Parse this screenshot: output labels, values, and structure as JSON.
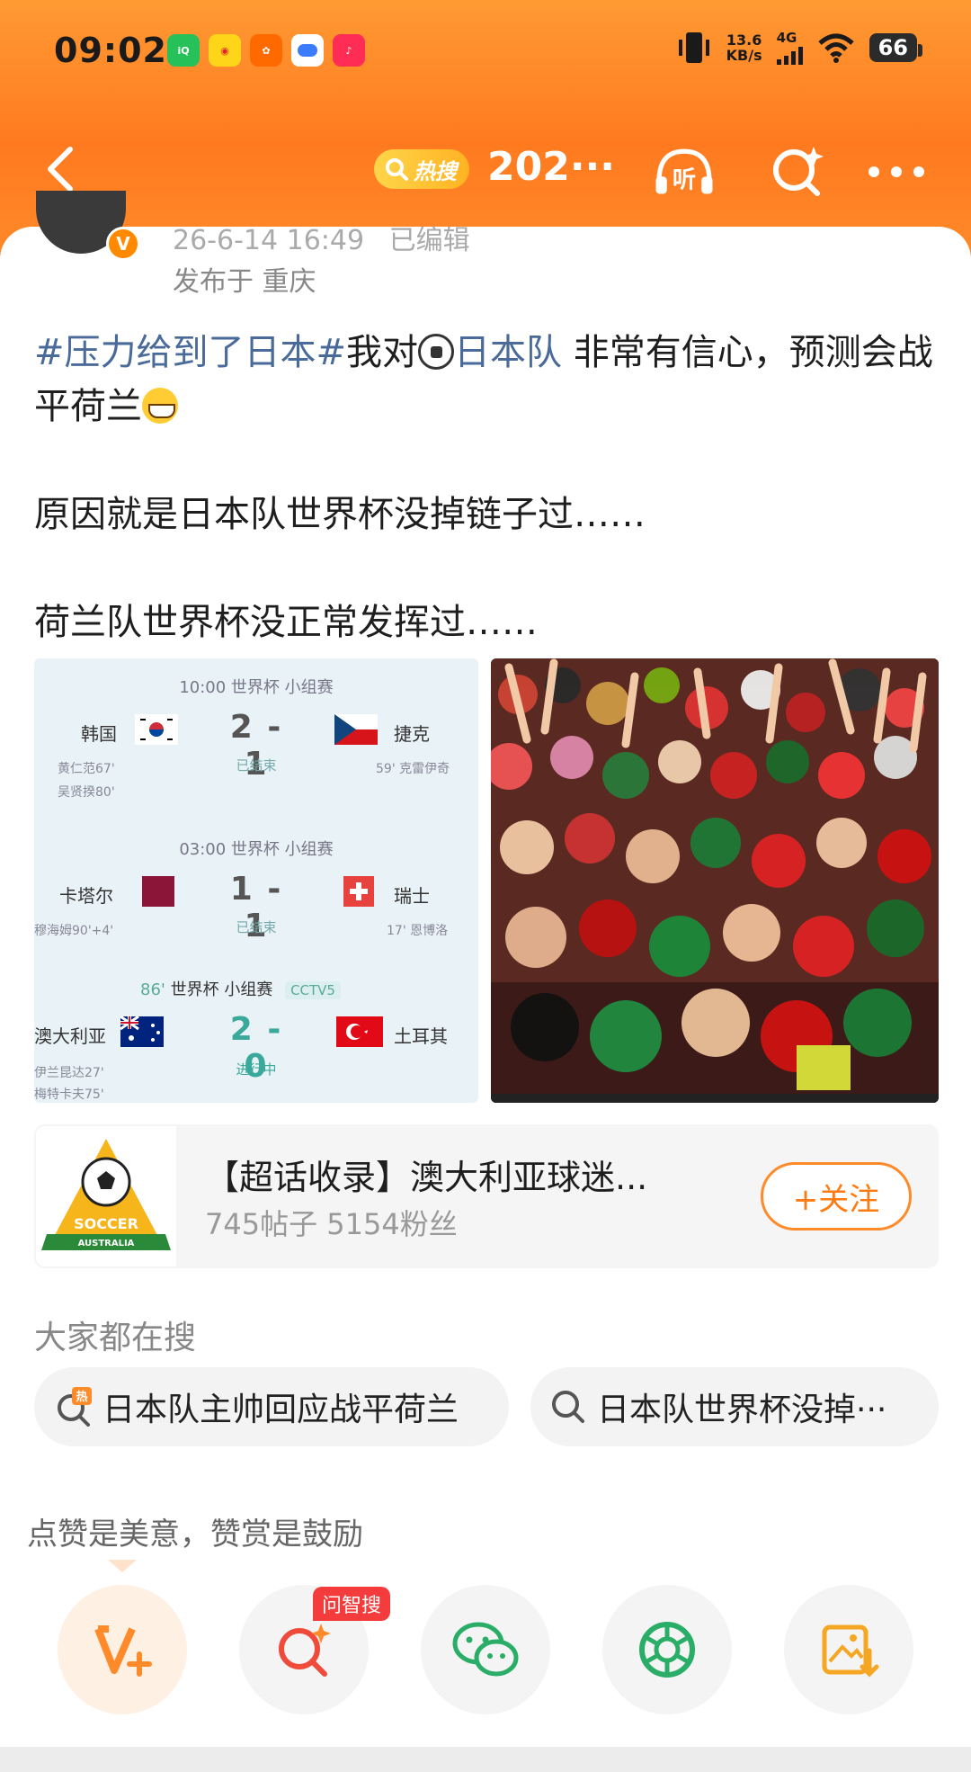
{
  "status_bar": {
    "time": "09:02",
    "speed_value": "13.6",
    "speed_unit": "KB/s",
    "network": "4G",
    "battery": "66"
  },
  "nav": {
    "hot_label": "热搜",
    "title": "202···",
    "listen_label": "听"
  },
  "post": {
    "timestamp": "26-6-14 16:49",
    "edited": "已编辑",
    "location": "发布于 重庆",
    "topic": "#压力给到了日本#",
    "text_a": "我对",
    "team_link": "日本队",
    "text_b": " 非常有信心，预测会战平荷兰",
    "line2": "原因就是日本队世界杯没掉链子过……",
    "line3": "荷兰队世界杯没正常发挥过……"
  },
  "scoreboard": {
    "matches": [
      {
        "header": "10:00 世界杯 小组赛",
        "home": "韩国",
        "away": "捷克",
        "score": "2 - 1",
        "status": "已结束",
        "home_scorers": [
          "黄仁范67'",
          "吴贤揆80'"
        ],
        "away_scorers": [
          "59' 克雷伊奇"
        ]
      },
      {
        "header": "03:00 世界杯 小组赛",
        "home": "卡塔尔",
        "away": "瑞士",
        "score": "1 - 1",
        "status": "已结束",
        "home_scorers": [
          "穆海姆90'+4'"
        ],
        "away_scorers": [
          "17' 恩博洛"
        ]
      },
      {
        "header_minute": "86'",
        "header": "世界杯 小组赛",
        "channel": "CCTV5",
        "home": "澳大利亚",
        "away": "土耳其",
        "score": "2 - 0",
        "status": "进行中",
        "home_scorers": [
          "伊兰昆达27'",
          "梅特卡夫75'"
        ],
        "away_scorers": []
      }
    ],
    "colors": {
      "korea": "#ffffff",
      "czech_red": "#d7141a",
      "czech_blue": "#11457e",
      "qatar": "#8a1538",
      "swiss": "#e8423f",
      "australia": "#00247d",
      "turkey": "#e30a17"
    }
  },
  "super_topic": {
    "logo_text_top": "SOCCER",
    "logo_text_bottom": "AUSTRALIA",
    "title": "【超话收录】澳大利亚球迷...",
    "stats": "745帖子 5154粉丝",
    "follow_label": "+关注"
  },
  "trending": {
    "title": "大家都在搜",
    "items": [
      {
        "label": "日本队主帅回应战平荷兰",
        "icon": "hot-search-icon"
      },
      {
        "label": "日本队世界杯没掉···",
        "icon": "search-icon"
      }
    ]
  },
  "reward": {
    "text": "点赞是美意，赞赏是鼓励",
    "ai_search_tag": "问智搜"
  },
  "share_buttons": [
    {
      "name": "reward-v-icon"
    },
    {
      "name": "ai-search-icon"
    },
    {
      "name": "wechat-icon"
    },
    {
      "name": "moments-icon"
    },
    {
      "name": "save-image-icon"
    }
  ],
  "accent_color": "#ff8a2a"
}
